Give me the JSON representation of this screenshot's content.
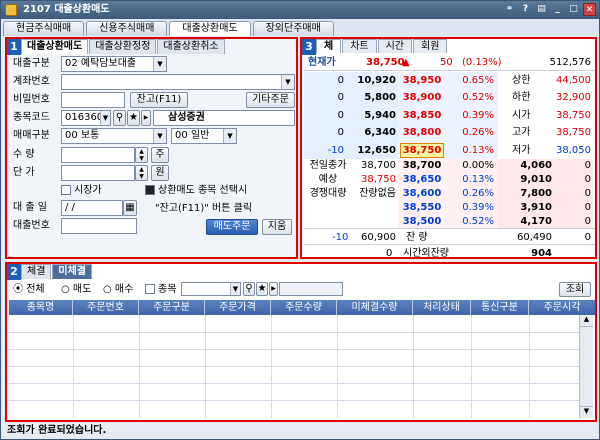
{
  "window": {
    "title": "2107 대출상환매도"
  },
  "menu_tabs": [
    "현금주식매매",
    "신용주식매매",
    "대출상환매도",
    "장외단주매매"
  ],
  "order_panel": {
    "number": "1",
    "tabs": [
      "대출상환매도",
      "대출상환정정",
      "대출상환취소"
    ],
    "loan_type_label": "대출구분",
    "loan_type_value": "02 예탁담보대출",
    "account_label": "계좌번호",
    "password_label": "비밀번호",
    "balance_btn": "잔고(F11)",
    "other_order_btn": "기타주문",
    "stock_code_label": "종목코드",
    "stock_code_value": "016360",
    "stock_name": "삼성증권",
    "trade_type_label": "매매구분",
    "trade_type_value": "00 보통",
    "trade_condition_value": "00 일반",
    "qty_label": "수   량",
    "qty_btn": "주",
    "price_label": "단   가",
    "price_btn": "원",
    "market_price_label": "시장가",
    "notice_line1": "상환매도 종목 선택시",
    "notice_line2": "\"잔고(F11)\" 버튼 클릭",
    "loan_date_label": "대 출 일",
    "loan_date_value": "  /  /",
    "loan_no_label": "대출번호",
    "sell_btn": "매도주문",
    "clear_btn": "지움"
  },
  "quote_panel": {
    "number": "3",
    "tabs": [
      "체",
      "차트",
      "시간",
      "회원"
    ],
    "current_label": "현재가",
    "current_price": "38,750",
    "change_arrow": "▲",
    "change": "50",
    "change_pct": "(0.13%)",
    "volume": "512,576",
    "asks": [
      {
        "chg": "0",
        "qty": "10,920",
        "price": "38,950",
        "pct": "0.65%",
        "info_label": "상한",
        "info_value": "44,500"
      },
      {
        "chg": "0",
        "qty": "5,800",
        "price": "38,900",
        "pct": "0.52%",
        "info_label": "하한",
        "info_value": "32,900"
      },
      {
        "chg": "0",
        "qty": "5,940",
        "price": "38,850",
        "pct": "0.39%",
        "info_label": "시가",
        "info_value": "38,750"
      },
      {
        "chg": "0",
        "qty": "6,340",
        "price": "38,800",
        "pct": "0.26%",
        "info_label": "고가",
        "info_value": "38,750"
      },
      {
        "chg": "-10",
        "qty": "12,650",
        "price": "38,750",
        "pct": "0.13%",
        "info_label": "저가",
        "info_value": "38,050"
      }
    ],
    "bids": [
      {
        "label": "전일종가",
        "value": "38,700",
        "price": "38,700",
        "pct": "0.00%",
        "qty": "4,060",
        "chg": "0"
      },
      {
        "label": "예상",
        "value": "38,750",
        "price": "38,650",
        "pct": "0.13%",
        "qty": "9,010",
        "chg": "0"
      },
      {
        "label": "경쟁대량",
        "value": "잔량없음",
        "price": "38,600",
        "pct": "0.26%",
        "qty": "7,800",
        "chg": "0"
      },
      {
        "label": "",
        "value": "",
        "price": "38,550",
        "pct": "0.39%",
        "qty": "3,910",
        "chg": "0"
      },
      {
        "label": "",
        "value": "",
        "price": "38,500",
        "pct": "0.52%",
        "qty": "4,170",
        "chg": "0"
      }
    ],
    "total_ask_chg": "-10",
    "total_ask": "60,900",
    "total_label": "잔 량",
    "total_bid": "60,490",
    "total_bid_chg": "0",
    "after_hours_chg": "0",
    "after_hours_label": "시간외잔량",
    "after_hours_value": "904"
  },
  "unfilled_panel": {
    "number": "2",
    "tabs": [
      "체결",
      "미체결"
    ],
    "filters": [
      "전체",
      "매도",
      "매수"
    ],
    "stock_filter_label": "종목",
    "query_btn": "조회",
    "columns": [
      "종목명",
      "주문번호",
      "주문구분",
      "주문가격",
      "주문수량",
      "미체결수량",
      "처리상태",
      "통신구분",
      "주문시각"
    ]
  },
  "status": "조회가 완료되었습니다."
}
